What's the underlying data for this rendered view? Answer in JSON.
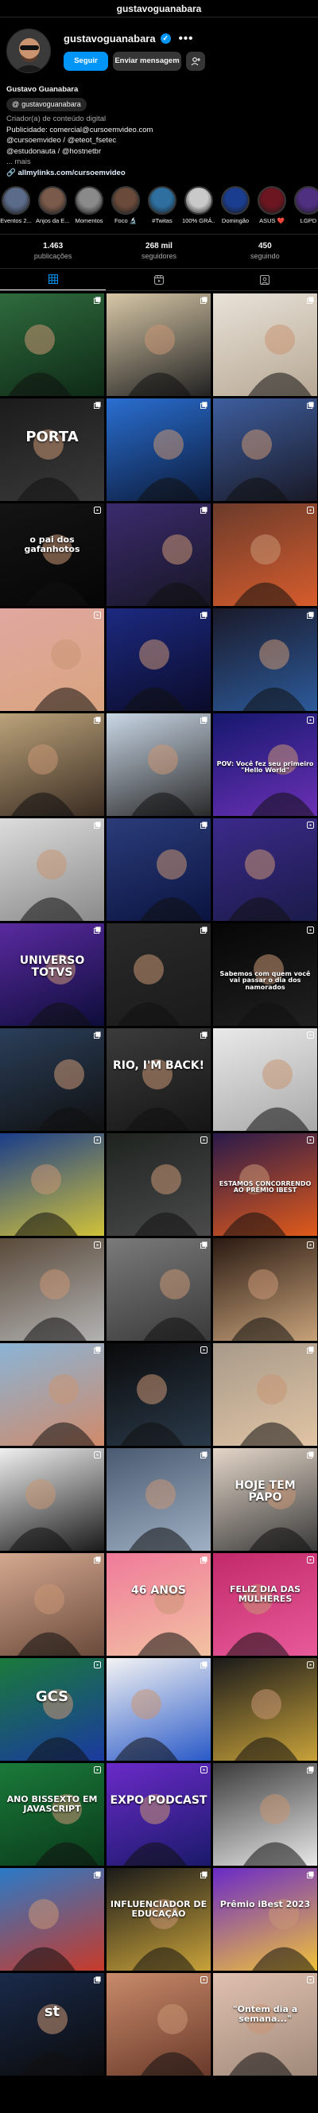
{
  "top_handle": "gustavoguanabara",
  "profile": {
    "username": "gustavoguanabara",
    "verified_mark": "✓",
    "more": "•••",
    "follow_label": "Seguir",
    "message_label": "Enviar mensagem",
    "add_person_label": "+⁂",
    "full_name": "Gustavo Guanabara",
    "threads_handle": "gustavoguanabara",
    "category": "Criador(a) de conteúdo digital",
    "bio_lines": [
      "Publicidade: comercial@cursoemvideo.com",
      "@cursoemvideo / @eteot_fsetec",
      "@estudonauta / @hostnetbr"
    ],
    "bio_more": "... mais",
    "link": "allmylinks.com/cursoemvideo"
  },
  "highlights": [
    {
      "label": "Eventos 2...",
      "color": "#5b6b8a"
    },
    {
      "label": "Anjos da E...",
      "color": "#7a5a4a"
    },
    {
      "label": "Momentos",
      "color": "#8a8a8a"
    },
    {
      "label": "Foco 🔬",
      "color": "#6a4a3a"
    },
    {
      "label": "#Twitas",
      "color": "#2e6fa0"
    },
    {
      "label": "100% GRÁ...",
      "color": "#c9c9c9"
    },
    {
      "label": "Domingão",
      "color": "#1b3d8f"
    },
    {
      "label": "ASUS ❤️",
      "color": "#6b1620"
    },
    {
      "label": "LGPD",
      "color": "#4f2f80"
    }
  ],
  "stats": [
    {
      "number": "1.463",
      "label": "publicações"
    },
    {
      "number": "268 mil",
      "label": "seguidores"
    },
    {
      "number": "450",
      "label": "seguindo"
    }
  ],
  "tabs": [
    "posts-grid",
    "reels",
    "tagged"
  ],
  "grid_posts": [
    {
      "bg": "#2f6b3d",
      "bg2": "#0e2a16",
      "text": "",
      "badge": "square"
    },
    {
      "bg": "#d7c7a6",
      "bg2": "#222",
      "text": "",
      "badge": "square"
    },
    {
      "bg": "#e8e2d8",
      "bg2": "#b7a894",
      "text": "",
      "badge": "square"
    },
    {
      "bg": "#1b1b1b",
      "bg2": "#3a3a3a",
      "text": "PORTA",
      "badge": "square"
    },
    {
      "bg": "#2a6fd1",
      "bg2": "#0b1a3a",
      "text": "",
      "badge": "square"
    },
    {
      "bg": "#3e5e9e",
      "bg2": "#191926",
      "text": "",
      "badge": "square"
    },
    {
      "bg": "#141414",
      "bg2": "#050505",
      "text": "o pai dos gafanhotos",
      "badge": "reel"
    },
    {
      "bg": "#3b2b6e",
      "bg2": "#171624",
      "text": "",
      "badge": "square"
    },
    {
      "bg": "#6b3b2b",
      "bg2": "#d65c2c",
      "text": "",
      "badge": "reel"
    },
    {
      "bg": "#e0a7a0",
      "bg2": "#d9a47f",
      "text": "",
      "badge": "reel"
    },
    {
      "bg": "#1c2a80",
      "bg2": "#0b0b2a",
      "text": "",
      "badge": "square"
    },
    {
      "bg": "#1a1a2a",
      "bg2": "#2c5a9a",
      "text": "",
      "badge": "square"
    },
    {
      "bg": "#bba37a",
      "bg2": "#3a2c22",
      "text": "",
      "badge": "square"
    },
    {
      "bg": "#c9d7e6",
      "bg2": "#2a2a2a",
      "text": "",
      "badge": "square"
    },
    {
      "bg": "#15186e",
      "bg2": "#6b30b5",
      "text": "POV: Você fez seu primeiro \"Hello World\"",
      "badge": "reel"
    },
    {
      "bg": "#dcdcdc",
      "bg2": "#8a8a8a",
      "text": "",
      "badge": "square"
    },
    {
      "bg": "#2b3c7a",
      "bg2": "#0a1440",
      "text": "",
      "badge": "square"
    },
    {
      "bg": "#3b2a8a",
      "bg2": "#1b1b4a",
      "text": "",
      "badge": "reel"
    },
    {
      "bg": "#5a2aa0",
      "bg2": "#0d0d3a",
      "text": "UNIVERSO TOTVS",
      "badge": "square"
    },
    {
      "bg": "#2a2a2a",
      "bg2": "#1a1a1a",
      "text": "",
      "badge": "square"
    },
    {
      "bg": "#060606",
      "bg2": "#202020",
      "text": "Sabemos com quem você vai passar o dia dos namorados",
      "badge": "reel"
    },
    {
      "bg": "#2a3f5a",
      "bg2": "#101010",
      "text": "",
      "badge": "square"
    },
    {
      "bg": "#3b3b3b",
      "bg2": "#151515",
      "text": "RIO, I'M BACK!",
      "badge": "square"
    },
    {
      "bg": "#e9e9e9",
      "bg2": "#a9a9a9",
      "text": "",
      "badge": "reel"
    },
    {
      "bg": "#1a3d8a",
      "bg2": "#d0c23a",
      "text": "",
      "badge": "reel"
    },
    {
      "bg": "#1e2320",
      "bg2": "#4a4a4a",
      "text": "",
      "badge": "reel"
    },
    {
      "bg": "#2a1a4a",
      "bg2": "#e05a1a",
      "text": "ESTAMOS CONCORRENDO AO PRÊMIO IBEST",
      "badge": "reel"
    },
    {
      "bg": "#5a4a3a",
      "bg2": "#b2b2b2",
      "text": "",
      "badge": "reel"
    },
    {
      "bg": "#7a7a7a",
      "bg2": "#3a3a3a",
      "text": "",
      "badge": "square"
    },
    {
      "bg": "#2a1a12",
      "bg2": "#c7a27a",
      "text": "",
      "badge": "reel"
    },
    {
      "bg": "#8ab4d6",
      "bg2": "#d08a6a",
      "text": "",
      "badge": "square"
    },
    {
      "bg": "#0a0a0a",
      "bg2": "#2a3a4a",
      "text": "",
      "badge": "reel"
    },
    {
      "bg": "#a89a8a",
      "bg2": "#e0c4a4",
      "text": "",
      "badge": "square"
    },
    {
      "bg": "#f0f0f0",
      "bg2": "#1a1a1a",
      "text": "",
      "badge": "reel"
    },
    {
      "bg": "#4a5a70",
      "bg2": "#9fb0c4",
      "text": "",
      "badge": "square"
    },
    {
      "bg": "#e4d6c8",
      "bg2": "#3a3a3a",
      "text": "HOJE TEM PAPO",
      "badge": "square"
    },
    {
      "bg": "#d4a890",
      "bg2": "#6a4a3a",
      "text": "",
      "badge": "square"
    },
    {
      "bg": "#f07a9a",
      "bg2": "#f2c2a2",
      "text": "46 ANOS",
      "badge": "square"
    },
    {
      "bg": "#c22a6a",
      "bg2": "#e85a9a",
      "text": "FELIZ DIA DAS MULHERES",
      "badge": "reel"
    },
    {
      "bg": "#1a7a3a",
      "bg2": "#1a3aa0",
      "text": "GCS",
      "badge": "reel"
    },
    {
      "bg": "#f3f3f3",
      "bg2": "#2a5ac8",
      "text": "",
      "badge": "square"
    },
    {
      "bg": "#1a1a1a",
      "bg2": "#c8a23a",
      "text": "",
      "badge": "reel"
    },
    {
      "bg": "#1a7a3a",
      "bg2": "#0a3a1a",
      "text": "ANO BISSEXTO EM JAVASCRIPT",
      "badge": "reel"
    },
    {
      "bg": "#6a2ac8",
      "bg2": "#1a1a6a",
      "text": "EXPO PODCAST",
      "badge": "reel"
    },
    {
      "bg": "#3a3a3a",
      "bg2": "#e8e8e8",
      "text": "",
      "badge": "square"
    },
    {
      "bg": "#2a7ac8",
      "bg2": "#c83a2a",
      "text": "",
      "badge": "square"
    },
    {
      "bg": "#1a1a1a",
      "bg2": "#c8a23a",
      "text": "INFLUENCIADOR DE EDUCAÇÃO",
      "badge": "square"
    },
    {
      "bg": "#6a2ac8",
      "bg2": "#f0c23a",
      "text": "Prêmio iBest 2023",
      "badge": "square"
    },
    {
      "bg": "#1a2a4a",
      "bg2": "#0a0a0a",
      "text": "st",
      "badge": "square"
    },
    {
      "bg": "#c88a6a",
      "bg2": "#6a3a2a",
      "text": "",
      "badge": "reel"
    },
    {
      "bg": "#e0c0b0",
      "bg2": "#a08a7a",
      "text": "\"Ontem dia a semana...\"",
      "badge": "reel"
    }
  ]
}
